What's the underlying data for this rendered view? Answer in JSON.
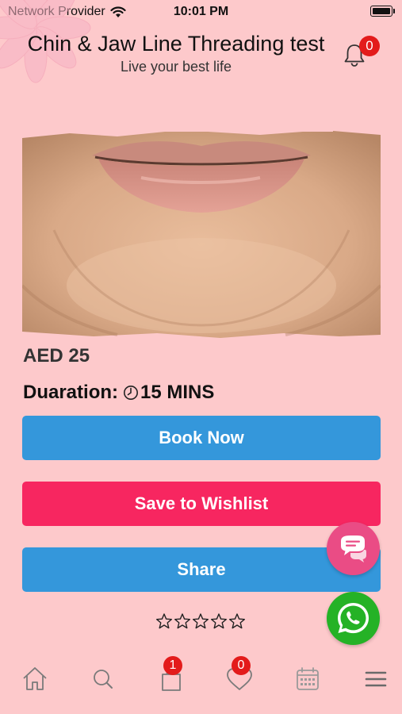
{
  "status_bar": {
    "carrier": "Network Provider",
    "time": "10:01 PM"
  },
  "header": {
    "title": "Chin & Jaw Line Threading test",
    "subtitle": "Live your best life",
    "notification_count": "0"
  },
  "product": {
    "image_icon": "chin-jaw-photo",
    "price": "AED 25",
    "duration_label": "Duaration:",
    "duration_value": "15 MINS",
    "rating_stars": 0,
    "rating_max": 5
  },
  "actions": {
    "book_label": "Book Now",
    "wishlist_label": "Save to Wishlist",
    "share_label": "Share"
  },
  "floating": {
    "chat_icon": "chat-bubbles-icon",
    "whatsapp_icon": "whatsapp-icon"
  },
  "tabbar": {
    "items": [
      {
        "icon": "home-icon"
      },
      {
        "icon": "search-icon"
      },
      {
        "icon": "shopping-bag-icon",
        "badge": "1"
      },
      {
        "icon": "heart-icon",
        "badge": "0"
      },
      {
        "icon": "calendar-icon"
      },
      {
        "icon": "menu-icon"
      }
    ]
  },
  "colors": {
    "background": "#fdc9cb",
    "primary_blue": "#3497db",
    "wishlist_pink": "#f72660",
    "chat_pink": "#ea4c85",
    "whatsapp_green": "#25b226",
    "badge_red": "#e31b1b"
  }
}
